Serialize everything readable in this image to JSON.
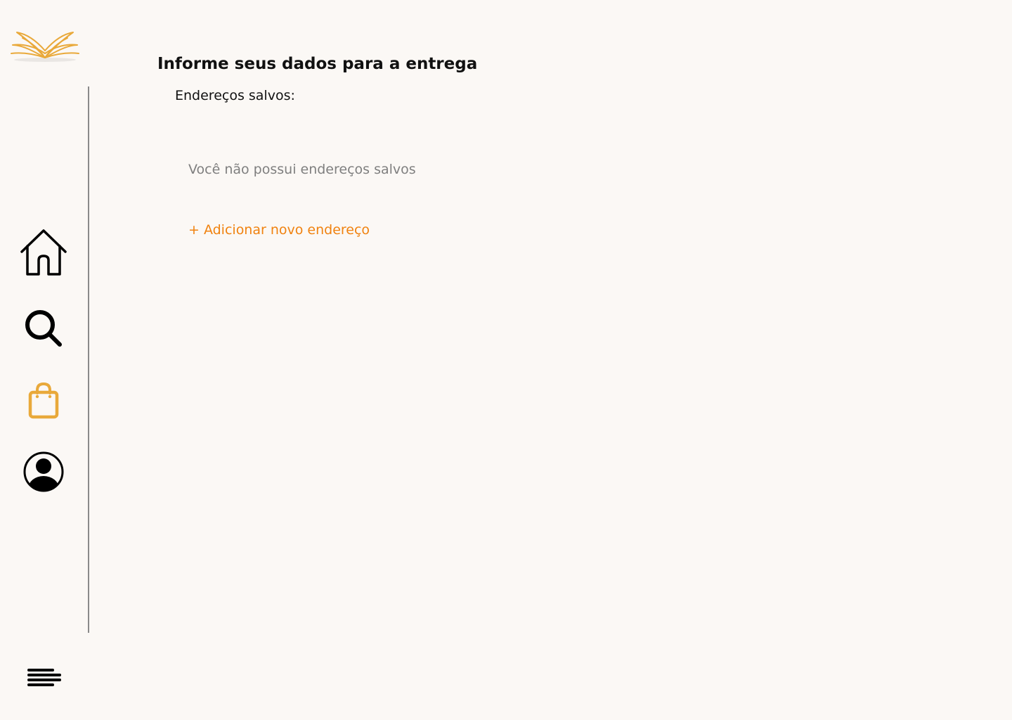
{
  "colors": {
    "background": "#fbf8f5",
    "accent_orange": "#f0820f",
    "accent_gold": "#e9a93a",
    "text_primary": "#111111",
    "text_muted": "#7f7f7f",
    "divider": "#8a8a8a"
  },
  "sidebar": {
    "logo_icon": "open-book-icon",
    "nav": [
      {
        "id": "home",
        "icon": "home-icon",
        "active": false
      },
      {
        "id": "search",
        "icon": "search-icon",
        "active": false
      },
      {
        "id": "bag",
        "icon": "shopping-bag-icon",
        "active": true
      },
      {
        "id": "profile",
        "icon": "user-circle-icon",
        "active": false
      }
    ],
    "menu_icon": "menu-icon"
  },
  "main": {
    "title": "Informe seus dados para a entrega",
    "saved_addresses_label": "Endereços salvos:",
    "empty_message": "Você não possui endereços salvos",
    "add_address_label": "+ Adicionar novo endereço"
  }
}
